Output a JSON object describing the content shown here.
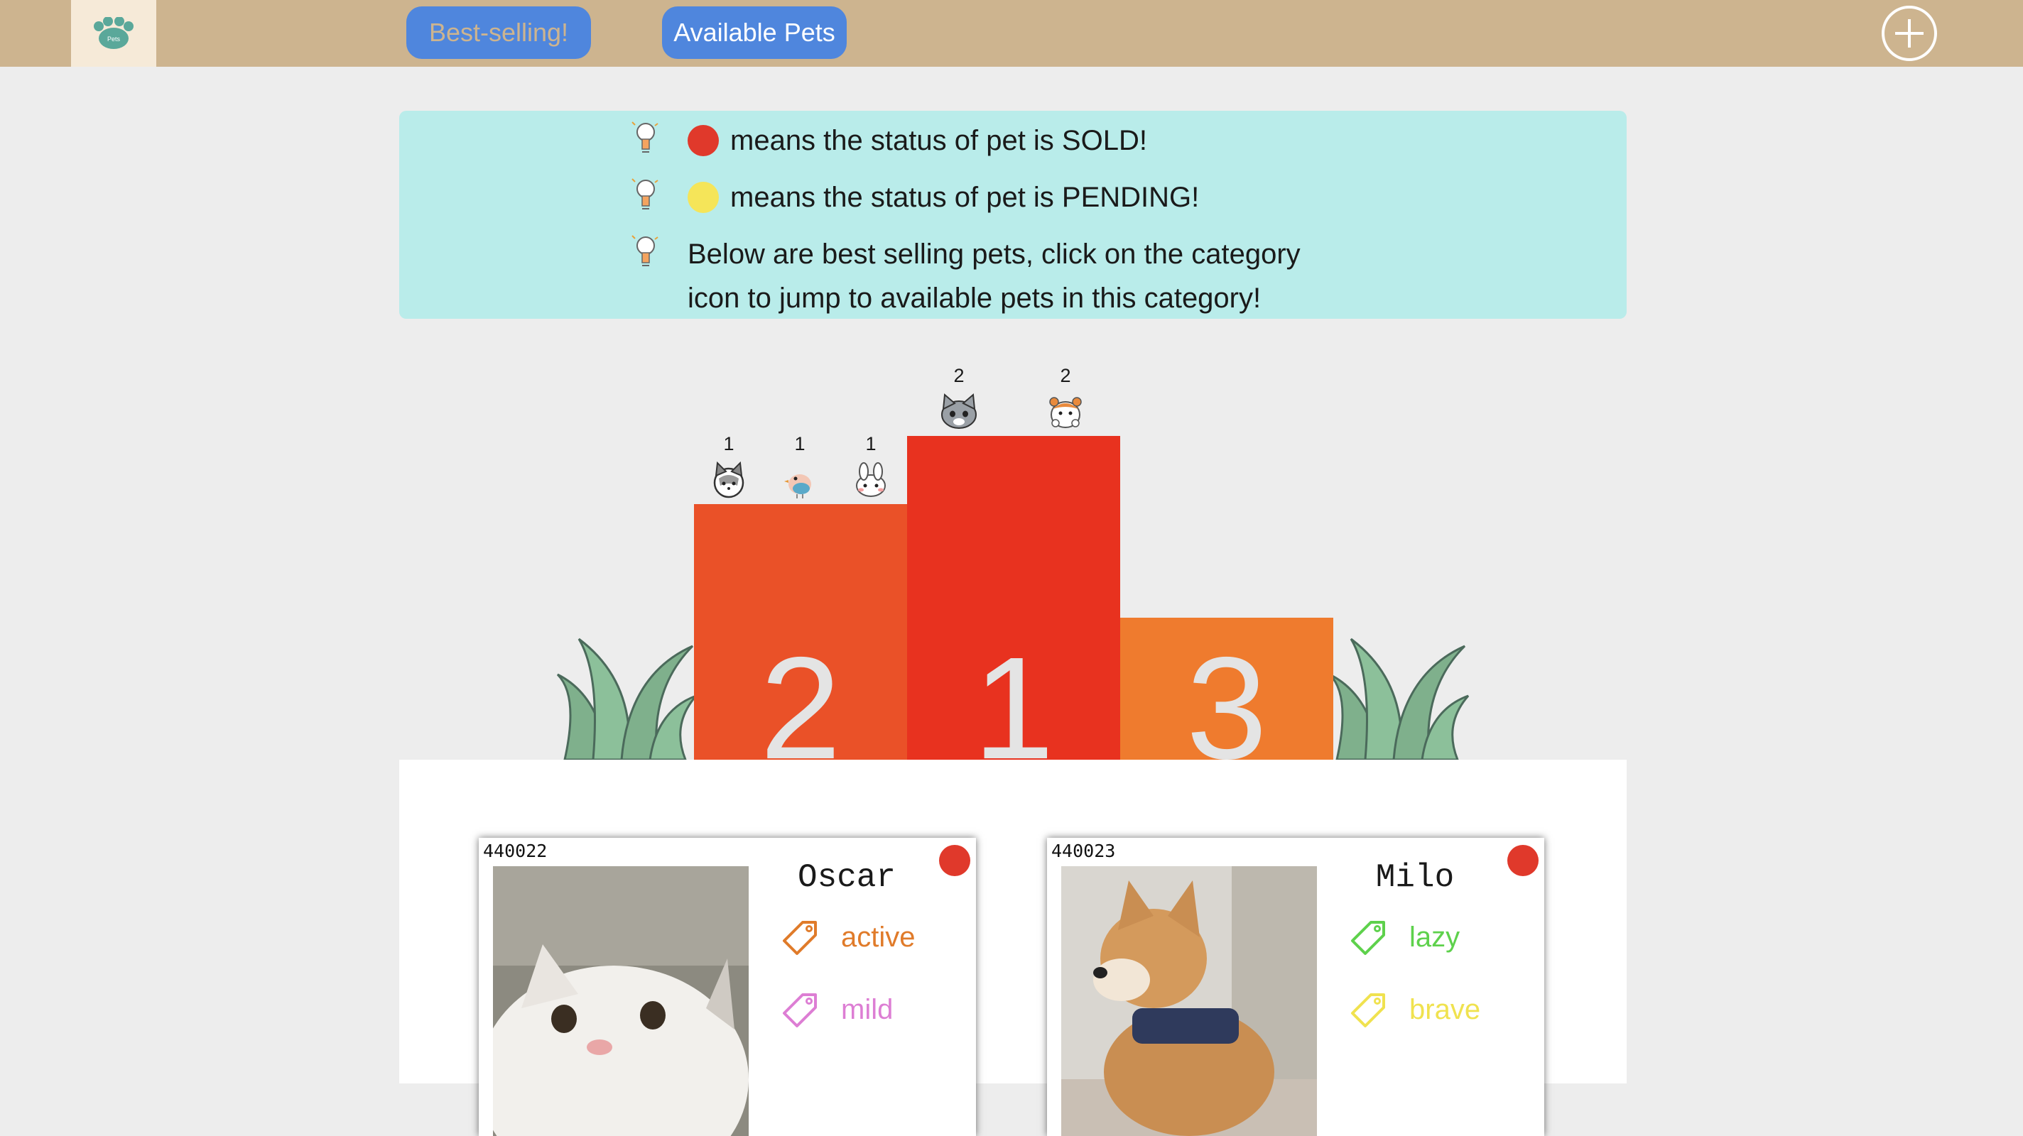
{
  "header": {
    "logo_text": "Pets",
    "best_selling_label": "Best-selling!",
    "available_label": "Available Pets"
  },
  "info": {
    "sold_text": "means the status of pet is SOLD!",
    "pending_text": "means the status of pet is PENDING!",
    "hint_line1": "Below are best selling pets, click on the category",
    "hint_line2": "icon to jump to available pets in this category!",
    "sold_color": "#e0392b",
    "pending_color": "#f5e559"
  },
  "chart_data": {
    "type": "bar",
    "title": "",
    "podium": [
      {
        "rank": "2",
        "color": "#ea5128",
        "pets": [
          {
            "icon": "husky-icon",
            "count": 1
          },
          {
            "icon": "bird-icon",
            "count": 1
          },
          {
            "icon": "rabbit-icon",
            "count": 1
          }
        ]
      },
      {
        "rank": "1",
        "color": "#e8321f",
        "pets": [
          {
            "icon": "cat-icon",
            "count": 2
          },
          {
            "icon": "hamster-icon",
            "count": 2
          }
        ]
      },
      {
        "rank": "3",
        "color": "#ef7b2e",
        "pets": []
      }
    ]
  },
  "cards": [
    {
      "id": "440022",
      "name": "Oscar",
      "photo": "white-cat-photo",
      "tags": [
        {
          "label": "active",
          "color": "#e07b2a"
        },
        {
          "label": "mild",
          "color": "#dd7ed4"
        }
      ],
      "status_color": "#e0392b"
    },
    {
      "id": "440023",
      "name": "Milo",
      "photo": "shiba-dog-photo",
      "tags": [
        {
          "label": "lazy",
          "color": "#5ed14c"
        },
        {
          "label": "brave",
          "color": "#f0e24f"
        }
      ],
      "status_color": "#e0392b"
    }
  ]
}
